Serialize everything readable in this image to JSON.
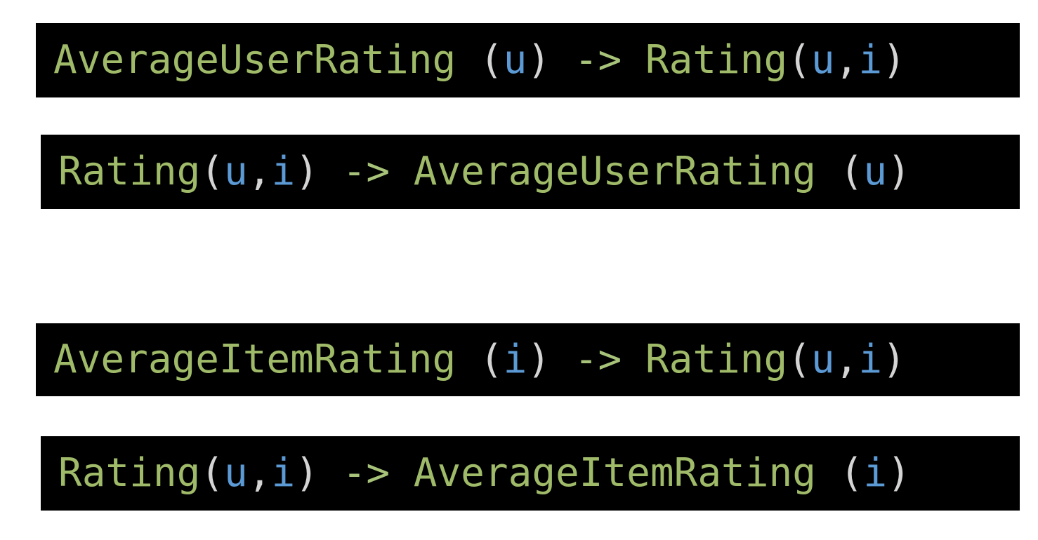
{
  "colors": {
    "background": "#000000",
    "identifier": "#9fba68",
    "variable": "#5c9ad6",
    "punctuation": "#d4d4d4",
    "arrow": "#a7c37a"
  },
  "lines": [
    {
      "tokens": [
        {
          "text": "AverageUserRating ",
          "kind": "fn"
        },
        {
          "text": "(",
          "kind": "punct"
        },
        {
          "text": "u",
          "kind": "var"
        },
        {
          "text": ")",
          "kind": "punct"
        },
        {
          "text": " -> ",
          "kind": "arrow"
        },
        {
          "text": "Rating",
          "kind": "fn"
        },
        {
          "text": "(",
          "kind": "punct"
        },
        {
          "text": "u",
          "kind": "var"
        },
        {
          "text": ",",
          "kind": "punct"
        },
        {
          "text": "i",
          "kind": "var"
        },
        {
          "text": ")",
          "kind": "punct"
        }
      ]
    },
    {
      "tokens": [
        {
          "text": "Rating",
          "kind": "fn"
        },
        {
          "text": "(",
          "kind": "punct"
        },
        {
          "text": "u",
          "kind": "var"
        },
        {
          "text": ",",
          "kind": "punct"
        },
        {
          "text": "i",
          "kind": "var"
        },
        {
          "text": ")",
          "kind": "punct"
        },
        {
          "text": " -> ",
          "kind": "arrow"
        },
        {
          "text": "AverageUserRating ",
          "kind": "fn"
        },
        {
          "text": "(",
          "kind": "punct"
        },
        {
          "text": "u",
          "kind": "var"
        },
        {
          "text": ")",
          "kind": "punct"
        }
      ]
    },
    {
      "tokens": [
        {
          "text": "AverageItemRating ",
          "kind": "fn"
        },
        {
          "text": "(",
          "kind": "punct"
        },
        {
          "text": "i",
          "kind": "var"
        },
        {
          "text": ")",
          "kind": "punct"
        },
        {
          "text": " -> ",
          "kind": "arrow"
        },
        {
          "text": "Rating",
          "kind": "fn"
        },
        {
          "text": "(",
          "kind": "punct"
        },
        {
          "text": "u",
          "kind": "var"
        },
        {
          "text": ",",
          "kind": "punct"
        },
        {
          "text": "i",
          "kind": "var"
        },
        {
          "text": ")",
          "kind": "punct"
        }
      ]
    },
    {
      "tokens": [
        {
          "text": "Rating",
          "kind": "fn"
        },
        {
          "text": "(",
          "kind": "punct"
        },
        {
          "text": "u",
          "kind": "var"
        },
        {
          "text": ",",
          "kind": "punct"
        },
        {
          "text": "i",
          "kind": "var"
        },
        {
          "text": ")",
          "kind": "punct"
        },
        {
          "text": " -> ",
          "kind": "arrow"
        },
        {
          "text": "AverageItemRating ",
          "kind": "fn"
        },
        {
          "text": "(",
          "kind": "punct"
        },
        {
          "text": "i",
          "kind": "var"
        },
        {
          "text": ")",
          "kind": "punct"
        }
      ]
    }
  ]
}
